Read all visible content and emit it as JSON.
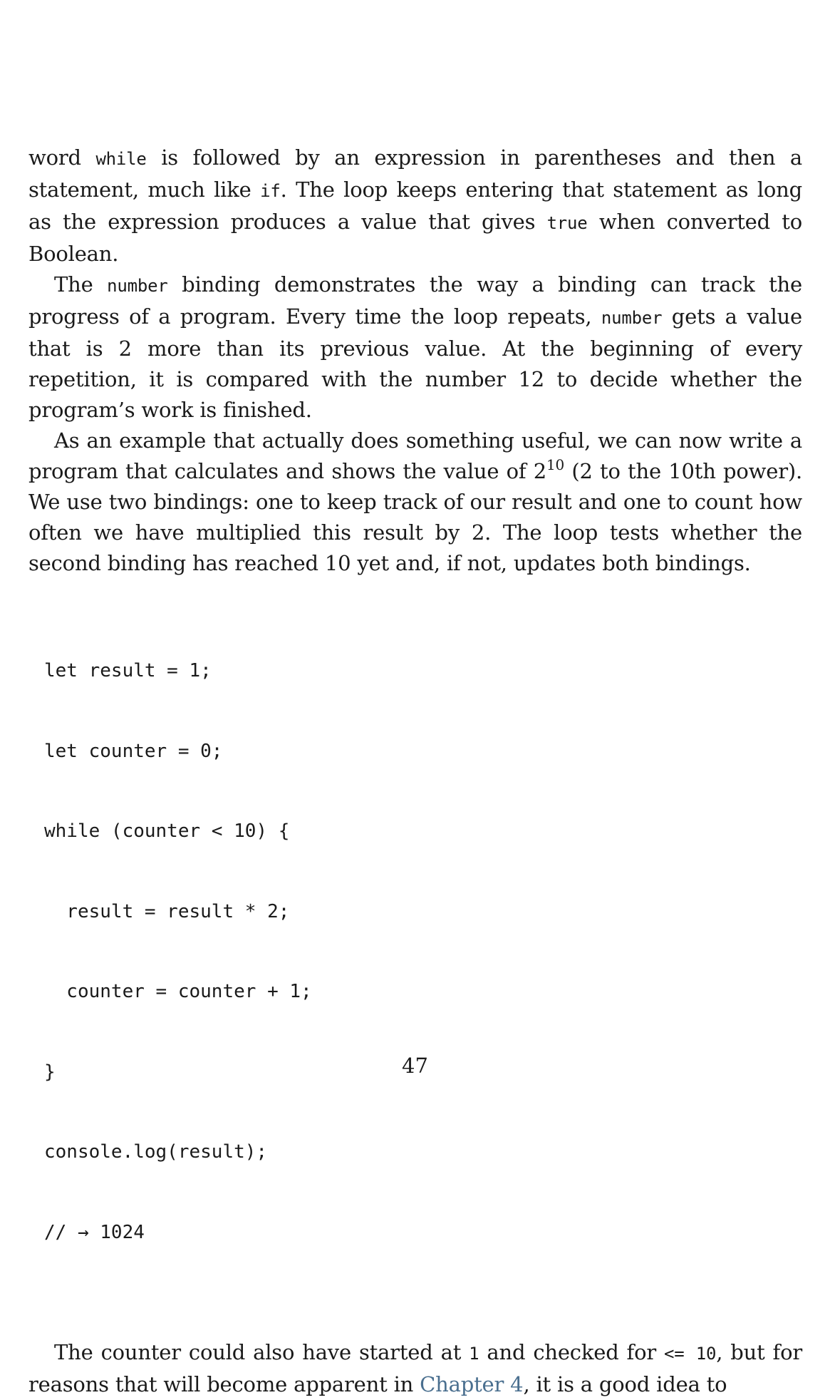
{
  "paragraphs": {
    "p1": {
      "t1": "word ",
      "c1": "while",
      "t2": " is followed by an expression in parentheses and then a statement, much like ",
      "c2": "if",
      "t3": ". The loop keeps entering that statement as long as the expression produces a value that gives ",
      "c3": "true",
      "t4": " when converted to Boolean."
    },
    "p2": {
      "t1": "The ",
      "c1": "number",
      "t2": " binding demonstrates the way a binding can track the progress of a program. Every time the loop repeats, ",
      "c2": "number",
      "t3": " gets a value that is 2 more than its previous value. At the beginning of every repetition, it is compared with the number 12 to decide whether the program’s work is finished."
    },
    "p3": {
      "t1": "As an example that actually does something useful, we can now write a program that calculates and shows the value of 2",
      "sup": "10",
      "t2": " (2 to the 10th power). We use two bindings: one to keep track of our result and one to count how often we have multiplied this result by 2. The loop tests whether the second binding has reached 10 yet and, if not, updates both bindings."
    },
    "p4": {
      "t1": "The counter could also have started at ",
      "c1": "1",
      "t2": " and checked for ",
      "c2": "<= 10",
      "t3": ", but for reasons that will become apparent in ",
      "link": "Chapter 4",
      "t4": ", it is a good idea to"
    }
  },
  "code_block": {
    "lines": [
      "let result = 1;",
      "let counter = 0;",
      "while (counter < 10) {",
      "  result = result * 2;",
      "  counter = counter + 1;",
      "}",
      "console.log(result);",
      "// → 1024"
    ]
  },
  "page_number": "47",
  "colors": {
    "text": "#1a1a1a",
    "link": "#4a6f8f",
    "background": "#ffffff"
  }
}
